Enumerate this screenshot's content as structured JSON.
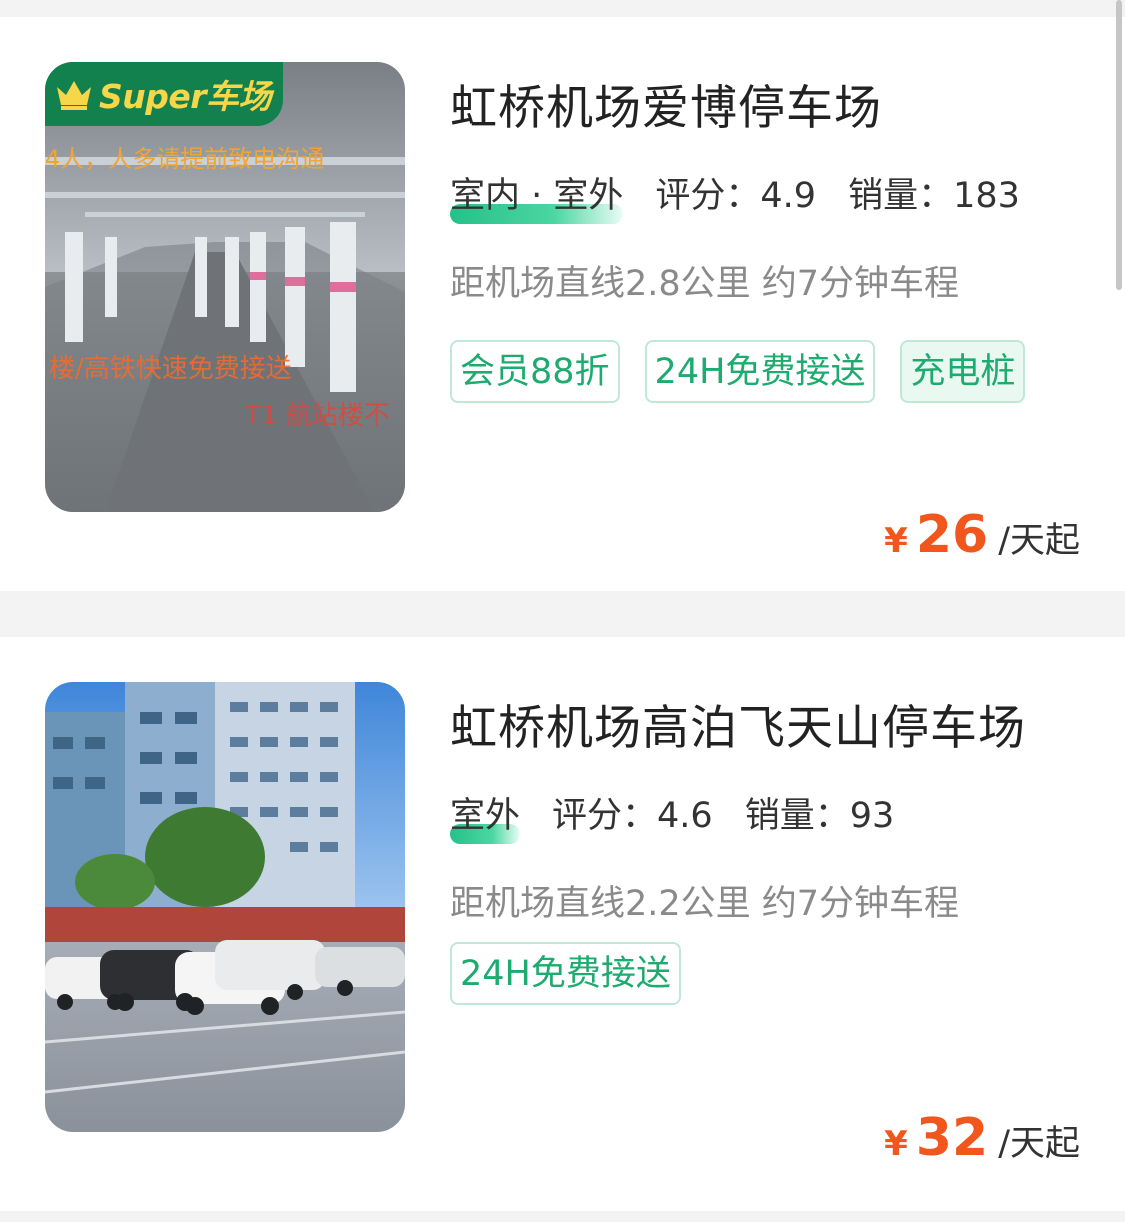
{
  "listings": [
    {
      "badge_text": "Super车场",
      "image_overlay": {
        "line1": "4人，人多请提前致电沟通",
        "line2": "楼/高铁快速免费接送",
        "line3": "T1 航站楼不"
      },
      "name": "虹桥机场爱博停车场",
      "location_type": "室内 · 室外",
      "rating_label": "评分：",
      "rating": "4.9",
      "sales_label": "销量：",
      "sales": "183",
      "distance": "距机场直线2.8公里 约7分钟车程",
      "tags": [
        "会员88折",
        "24H免费接送",
        "充电桩"
      ],
      "price_symbol": "¥",
      "price": "26",
      "price_unit": "/天起"
    },
    {
      "name": "虹桥机场高泊飞天山停车场",
      "location_type": "室外",
      "rating_label": "评分：",
      "rating": "4.6",
      "sales_label": "销量：",
      "sales": "93",
      "distance": "距机场直线2.2公里 约7分钟车程",
      "tags": [
        "24H免费接送"
      ],
      "price_symbol": "¥",
      "price": "32",
      "price_unit": "/天起"
    }
  ],
  "colors": {
    "accent_green": "#1eab6f",
    "price_orange": "#f1571d",
    "badge_green": "#12814d"
  }
}
